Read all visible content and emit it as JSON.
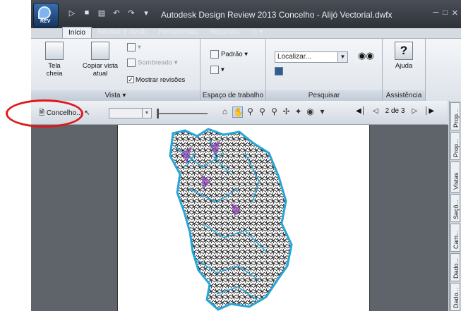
{
  "app": {
    "title": "Autodesk Design Review 2013   Concelho - Alijó Vectorial.dwfx",
    "badge": "REV"
  },
  "ribbon_tabs": [
    "Início",
    "Revisar e medir",
    "Ferramentas",
    "Recursos"
  ],
  "ribbon": {
    "vista": {
      "tela_cheia": "Tela cheia",
      "copiar": "Copiar vista",
      "copiar2": "atual",
      "sombreado": "Sombreado",
      "mostrar": "Mostrar revisões",
      "title": "Vista"
    },
    "espaco": {
      "padrao": "Padrão",
      "title": "Espaço de trabalho"
    },
    "pesquisar": {
      "search_value": "Localizar...",
      "title": "Pesquisar"
    },
    "assistencia": {
      "ajuda": "Ajuda",
      "title": "Assistência"
    }
  },
  "doc_toolbar": {
    "doc_name": "Concelho...",
    "page": "2 de 3"
  },
  "side_tabs": [
    "Prop...",
    "Prop...",
    "Vistas",
    "Seçõ...",
    "Cam...",
    "Dado...",
    "Dado..."
  ],
  "colors": {
    "map_black": "#111111",
    "map_blue": "#25a6d8",
    "map_purple": "#8a3fb5",
    "highlight_ring": "#e0181b"
  }
}
